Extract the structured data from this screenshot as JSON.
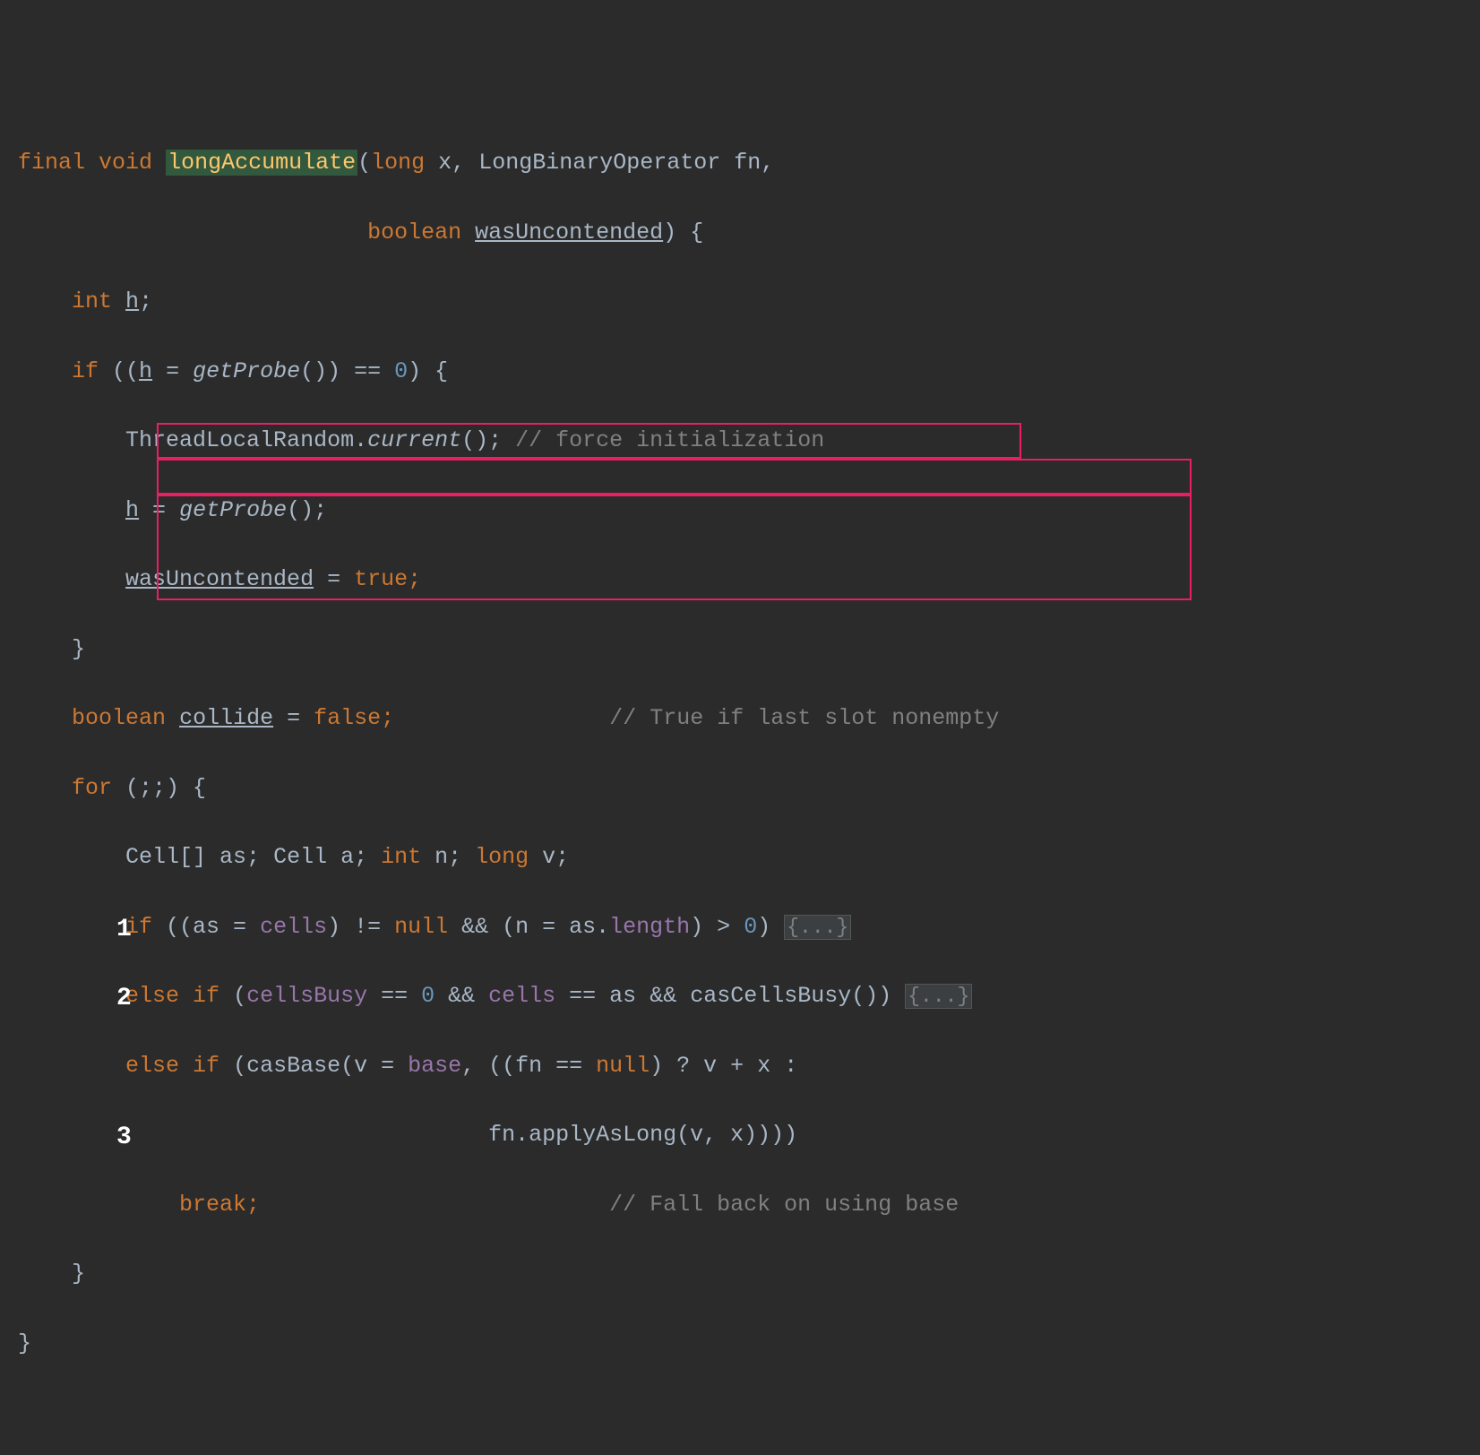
{
  "code": {
    "l1": {
      "kw_final": "final",
      "kw_void": "void",
      "method": "longAccumulate",
      "lparen": "(",
      "type_long": "long",
      "param_x": "x",
      "comma": ",",
      "type_op": "LongBinaryOperator",
      "param_fn": "fn",
      "comma2": ","
    },
    "l2": {
      "kw_boolean": "boolean",
      "param_was": "wasUncontended",
      "rparen": ")",
      "lbrace": "{"
    },
    "l3": {
      "kw_int": "int",
      "var_h": "h",
      "semi": ";"
    },
    "l4": {
      "kw_if": "if",
      "text": " ((",
      "var_h": "h",
      "text2": " = ",
      "method": "getProbe",
      "text3": "()) == ",
      "num": "0",
      "text4": ") {"
    },
    "l5": {
      "cls": "ThreadLocalRandom",
      "dot": ".",
      "method": "current",
      "text": "();",
      "comment": "// force initialization"
    },
    "l6": {
      "var_h": "h",
      "text": " = ",
      "method": "getProbe",
      "text2": "();"
    },
    "l7": {
      "var": "wasUncontended",
      "text": " = ",
      "kw_true": "true",
      "semi": ";"
    },
    "l8": {
      "brace": "}"
    },
    "l9": {
      "kw_boolean": "boolean",
      "var": "collide",
      "text": " = ",
      "kw_false": "false",
      "semi": ";",
      "comment": "// True if last slot nonempty"
    },
    "l10": {
      "kw_for": "for",
      "text": " (;;) {"
    },
    "l11": {
      "type": "Cell",
      "text": "[] as; ",
      "type2": "Cell",
      "text2": " a; ",
      "kw_int": "int",
      "text3": " n; ",
      "kw_long": "long",
      "text4": " v;"
    },
    "l12": {
      "kw_if": "if",
      "text": " ((as = ",
      "field": "cells",
      "text2": ") != ",
      "kw_null": "null",
      "text3": " && (n = as.",
      "field2": "length",
      "text4": ") > ",
      "num": "0",
      "text5": ") ",
      "fold": "{...}"
    },
    "l13": {
      "kw_else": "else if",
      "text": " (",
      "field": "cellsBusy",
      "text2": " == ",
      "num": "0",
      "text3": " && ",
      "field2": "cells",
      "text4": " == as && casCellsBusy()) ",
      "fold": "{...}"
    },
    "l14": {
      "kw_else": "else if",
      "text": " (casBase(v = ",
      "field": "base",
      "text2": ", ((fn == ",
      "kw_null": "null",
      "text3": ") ? v + x :"
    },
    "l15": {
      "text": "fn.applyAsLong(v, x))))"
    },
    "l16": {
      "kw_break": "break",
      "semi": ";",
      "comment": "// Fall back on using base"
    },
    "l17": {
      "brace": "}"
    },
    "l18": {
      "brace": "}"
    }
  },
  "annotations": {
    "a1": "1",
    "a2": "2",
    "a3": "3"
  }
}
